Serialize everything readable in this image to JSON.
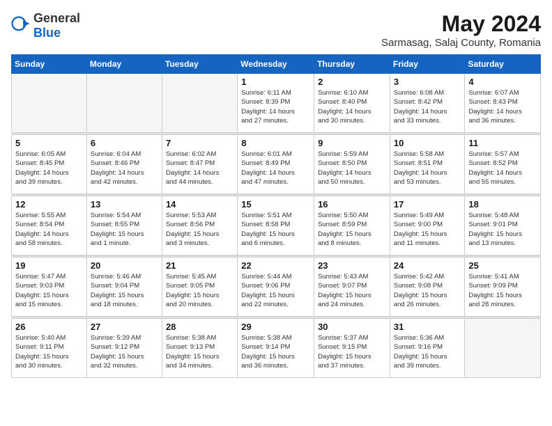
{
  "header": {
    "logo_general": "General",
    "logo_blue": "Blue",
    "month_year": "May 2024",
    "location": "Sarmasag, Salaj County, Romania"
  },
  "weekdays": [
    "Sunday",
    "Monday",
    "Tuesday",
    "Wednesday",
    "Thursday",
    "Friday",
    "Saturday"
  ],
  "weeks": [
    [
      {
        "day": "",
        "info": ""
      },
      {
        "day": "",
        "info": ""
      },
      {
        "day": "",
        "info": ""
      },
      {
        "day": "1",
        "info": "Sunrise: 6:11 AM\nSunset: 8:39 PM\nDaylight: 14 hours\nand 27 minutes."
      },
      {
        "day": "2",
        "info": "Sunrise: 6:10 AM\nSunset: 8:40 PM\nDaylight: 14 hours\nand 30 minutes."
      },
      {
        "day": "3",
        "info": "Sunrise: 6:08 AM\nSunset: 8:42 PM\nDaylight: 14 hours\nand 33 minutes."
      },
      {
        "day": "4",
        "info": "Sunrise: 6:07 AM\nSunset: 8:43 PM\nDaylight: 14 hours\nand 36 minutes."
      }
    ],
    [
      {
        "day": "5",
        "info": "Sunrise: 6:05 AM\nSunset: 8:45 PM\nDaylight: 14 hours\nand 39 minutes."
      },
      {
        "day": "6",
        "info": "Sunrise: 6:04 AM\nSunset: 8:46 PM\nDaylight: 14 hours\nand 42 minutes."
      },
      {
        "day": "7",
        "info": "Sunrise: 6:02 AM\nSunset: 8:47 PM\nDaylight: 14 hours\nand 44 minutes."
      },
      {
        "day": "8",
        "info": "Sunrise: 6:01 AM\nSunset: 8:49 PM\nDaylight: 14 hours\nand 47 minutes."
      },
      {
        "day": "9",
        "info": "Sunrise: 5:59 AM\nSunset: 8:50 PM\nDaylight: 14 hours\nand 50 minutes."
      },
      {
        "day": "10",
        "info": "Sunrise: 5:58 AM\nSunset: 8:51 PM\nDaylight: 14 hours\nand 53 minutes."
      },
      {
        "day": "11",
        "info": "Sunrise: 5:57 AM\nSunset: 8:52 PM\nDaylight: 14 hours\nand 55 minutes."
      }
    ],
    [
      {
        "day": "12",
        "info": "Sunrise: 5:55 AM\nSunset: 8:54 PM\nDaylight: 14 hours\nand 58 minutes."
      },
      {
        "day": "13",
        "info": "Sunrise: 5:54 AM\nSunset: 8:55 PM\nDaylight: 15 hours\nand 1 minute."
      },
      {
        "day": "14",
        "info": "Sunrise: 5:53 AM\nSunset: 8:56 PM\nDaylight: 15 hours\nand 3 minutes."
      },
      {
        "day": "15",
        "info": "Sunrise: 5:51 AM\nSunset: 8:58 PM\nDaylight: 15 hours\nand 6 minutes."
      },
      {
        "day": "16",
        "info": "Sunrise: 5:50 AM\nSunset: 8:59 PM\nDaylight: 15 hours\nand 8 minutes."
      },
      {
        "day": "17",
        "info": "Sunrise: 5:49 AM\nSunset: 9:00 PM\nDaylight: 15 hours\nand 11 minutes."
      },
      {
        "day": "18",
        "info": "Sunrise: 5:48 AM\nSunset: 9:01 PM\nDaylight: 15 hours\nand 13 minutes."
      }
    ],
    [
      {
        "day": "19",
        "info": "Sunrise: 5:47 AM\nSunset: 9:03 PM\nDaylight: 15 hours\nand 15 minutes."
      },
      {
        "day": "20",
        "info": "Sunrise: 5:46 AM\nSunset: 9:04 PM\nDaylight: 15 hours\nand 18 minutes."
      },
      {
        "day": "21",
        "info": "Sunrise: 5:45 AM\nSunset: 9:05 PM\nDaylight: 15 hours\nand 20 minutes."
      },
      {
        "day": "22",
        "info": "Sunrise: 5:44 AM\nSunset: 9:06 PM\nDaylight: 15 hours\nand 22 minutes."
      },
      {
        "day": "23",
        "info": "Sunrise: 5:43 AM\nSunset: 9:07 PM\nDaylight: 15 hours\nand 24 minutes."
      },
      {
        "day": "24",
        "info": "Sunrise: 5:42 AM\nSunset: 9:08 PM\nDaylight: 15 hours\nand 26 minutes."
      },
      {
        "day": "25",
        "info": "Sunrise: 5:41 AM\nSunset: 9:09 PM\nDaylight: 15 hours\nand 28 minutes."
      }
    ],
    [
      {
        "day": "26",
        "info": "Sunrise: 5:40 AM\nSunset: 9:11 PM\nDaylight: 15 hours\nand 30 minutes."
      },
      {
        "day": "27",
        "info": "Sunrise: 5:39 AM\nSunset: 9:12 PM\nDaylight: 15 hours\nand 32 minutes."
      },
      {
        "day": "28",
        "info": "Sunrise: 5:38 AM\nSunset: 9:13 PM\nDaylight: 15 hours\nand 34 minutes."
      },
      {
        "day": "29",
        "info": "Sunrise: 5:38 AM\nSunset: 9:14 PM\nDaylight: 15 hours\nand 36 minutes."
      },
      {
        "day": "30",
        "info": "Sunrise: 5:37 AM\nSunset: 9:15 PM\nDaylight: 15 hours\nand 37 minutes."
      },
      {
        "day": "31",
        "info": "Sunrise: 5:36 AM\nSunset: 9:16 PM\nDaylight: 15 hours\nand 39 minutes."
      },
      {
        "day": "",
        "info": ""
      }
    ]
  ]
}
